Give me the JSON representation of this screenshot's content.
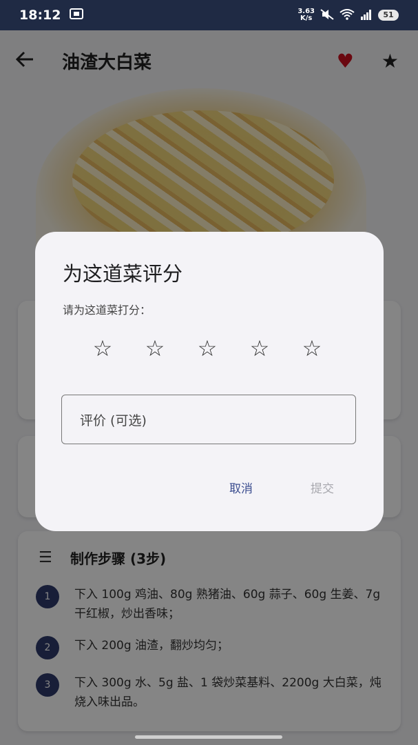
{
  "status_bar": {
    "time": "18:12",
    "net_speed_value": "3.63",
    "net_speed_unit": "K/s",
    "battery": "51"
  },
  "app_bar": {
    "title": "油渣大白菜"
  },
  "steps": {
    "header": "制作步骤 (3步)",
    "items": [
      {
        "num": "1",
        "text": "下入 100g 鸡油、80g 熟猪油、60g 蒜子、60g 生姜、7g 干红椒，炒出香味；"
      },
      {
        "num": "2",
        "text": "下入 200g 油渣，翻炒均匀；"
      },
      {
        "num": "3",
        "text": "下入 300g 水、5g 盐、1 袋炒菜基料、2200g 大白菜，炖烧入味出品。"
      }
    ]
  },
  "dialog": {
    "title": "为这道菜评分",
    "subtitle": "请为这道菜打分：",
    "rating": 0,
    "max_rating": 5,
    "review_placeholder": "评价 (可选)",
    "cancel_label": "取消",
    "submit_label": "提交"
  },
  "colors": {
    "status_bar_bg": "#1f2a44",
    "accent": "#3b4d8f",
    "favorite": "#cc1020",
    "step_badge": "#2f3b6b"
  }
}
